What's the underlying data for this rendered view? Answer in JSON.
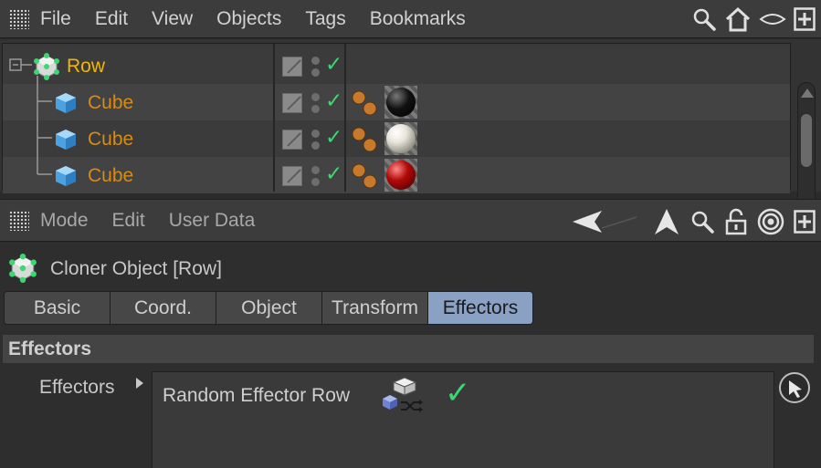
{
  "object_manager": {
    "menu": [
      "File",
      "Edit",
      "View",
      "Objects",
      "Tags",
      "Bookmarks"
    ],
    "toolbar_icons": [
      "search-icon",
      "home-icon",
      "eye-icon",
      "new-window-icon"
    ],
    "tree": [
      {
        "name": "Row",
        "type": "cloner",
        "level": 0,
        "tags": []
      },
      {
        "name": "Cube",
        "type": "cube",
        "level": 1,
        "tags": [
          "phong-tag",
          "material-black"
        ]
      },
      {
        "name": "Cube",
        "type": "cube",
        "level": 1,
        "tags": [
          "phong-tag",
          "material-white"
        ]
      },
      {
        "name": "Cube",
        "type": "cube",
        "level": 1,
        "tags": [
          "phong-tag",
          "material-red"
        ]
      }
    ],
    "material_colors": {
      "black": "#111111",
      "white": "#e8e6da",
      "red": "#b30a0a"
    }
  },
  "attribute_manager": {
    "menu": [
      "Mode",
      "Edit",
      "User Data"
    ],
    "toolbar_icons": [
      "back-arrow-icon",
      "up-arrow-icon",
      "search-icon",
      "lock-icon",
      "target-icon",
      "new-window-icon"
    ],
    "object_title": "Cloner Object [Row]",
    "tabs": [
      "Basic",
      "Coord.",
      "Object",
      "Transform",
      "Effectors"
    ],
    "active_tab": "Effectors",
    "section": "Effectors",
    "field_label": "Effectors",
    "effectors_list": [
      {
        "name": "Random Effector Row",
        "enabled": true
      }
    ]
  },
  "colors": {
    "root_label": "#f2b600",
    "child_label": "#d98a12",
    "check": "#3bd870",
    "active_tab": "#8aa1c4"
  }
}
